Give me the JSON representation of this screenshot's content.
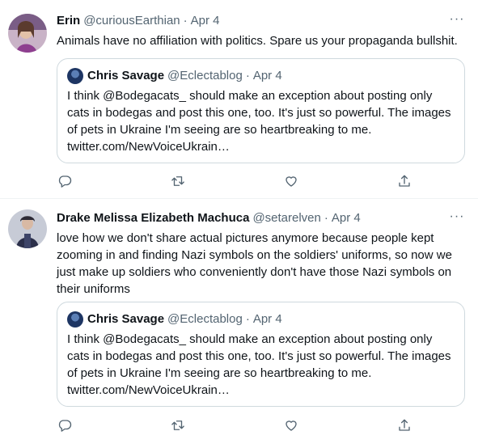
{
  "tweets": [
    {
      "name": "Erin",
      "handle": "@curiousEarthian",
      "separator": "·",
      "date": "Apr 4",
      "text": "Animals have no affiliation with politics. Spare us your propaganda bullshit.",
      "quote": {
        "name": "Chris Savage",
        "handle": "@Eclectablog",
        "separator": "·",
        "date": "Apr 4",
        "text": "I think @Bodegacats_ should make an exception about posting only cats in bodegas and post this one, too. It's just so powerful. The images of pets in Ukraine I'm seeing are so heartbreaking to me. twitter.com/NewVoiceUkrain…"
      }
    },
    {
      "name": "Drake Melissa Elizabeth Machuca",
      "handle": "@setarelven",
      "separator": "·",
      "date": "Apr 4",
      "text": "love how we don't share actual pictures anymore because people kept zooming in and finding Nazi symbols on the soldiers' uniforms, so now we just make up soldiers who conveniently don't have those Nazi symbols on their uniforms",
      "quote": {
        "name": "Chris Savage",
        "handle": "@Eclectablog",
        "separator": "·",
        "date": "Apr 4",
        "text": "I think @Bodegacats_ should make an exception about posting only cats in bodegas and post this one, too. It's just so powerful. The images of pets in Ukraine I'm seeing are so heartbreaking to me. twitter.com/NewVoiceUkrain…"
      }
    }
  ],
  "icons": {
    "reply": "reply-icon",
    "retweet": "retweet-icon",
    "like": "like-icon",
    "share": "share-icon",
    "more": "more-icon"
  },
  "colors": {
    "text": "#0f1419",
    "secondary": "#536471",
    "border": "#cfd9de"
  },
  "more_glyph": "···"
}
